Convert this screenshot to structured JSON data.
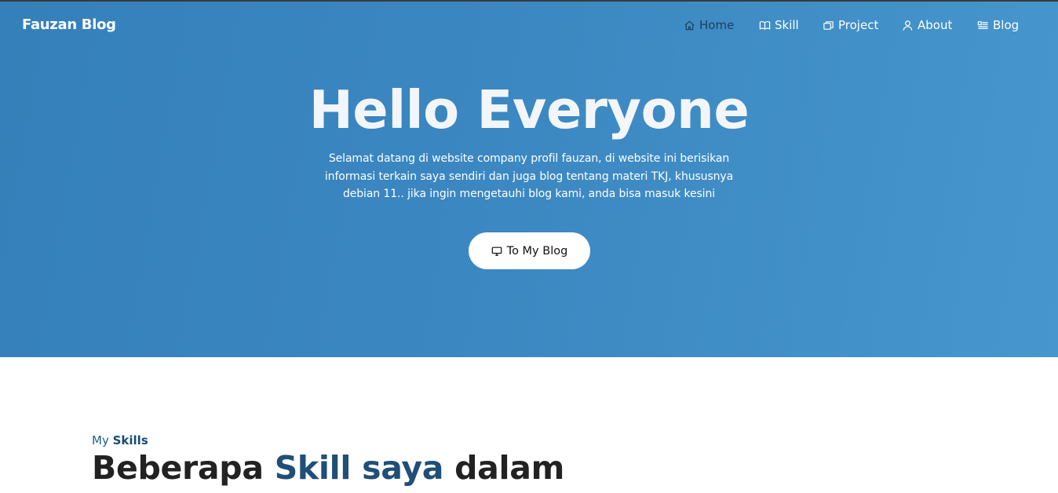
{
  "brand": "Fauzan Blog",
  "nav": [
    {
      "label": "Home",
      "icon": "home-icon",
      "active": true
    },
    {
      "label": "Skill",
      "icon": "book-icon",
      "active": false
    },
    {
      "label": "Project",
      "icon": "windows-icon",
      "active": false
    },
    {
      "label": "About",
      "icon": "person-icon",
      "active": false
    },
    {
      "label": "Blog",
      "icon": "list-icon",
      "active": false
    }
  ],
  "hero": {
    "title": "Hello Everyone",
    "description": "Selamat datang di website company profil fauzan, di website ini berisikan informasi terkain saya sendiri dan juga blog tentang materi TKJ, khususnya debian 11.. jika ingin mengetauhi blog kami, anda bisa masuk kesini",
    "cta_label": "To My Blog",
    "cta_icon": "monitor-icon"
  },
  "skills": {
    "kicker_prefix": "My",
    "kicker_bold": "Skills",
    "title_part1": "Beberapa",
    "title_highlight": "Skill saya",
    "title_part2": "dalam"
  },
  "colors": {
    "hero_gradient_start": "#3580ba",
    "hero_gradient_end": "#4796cd",
    "nav_active": "#1b3f5e",
    "accent": "#1f4f78"
  }
}
